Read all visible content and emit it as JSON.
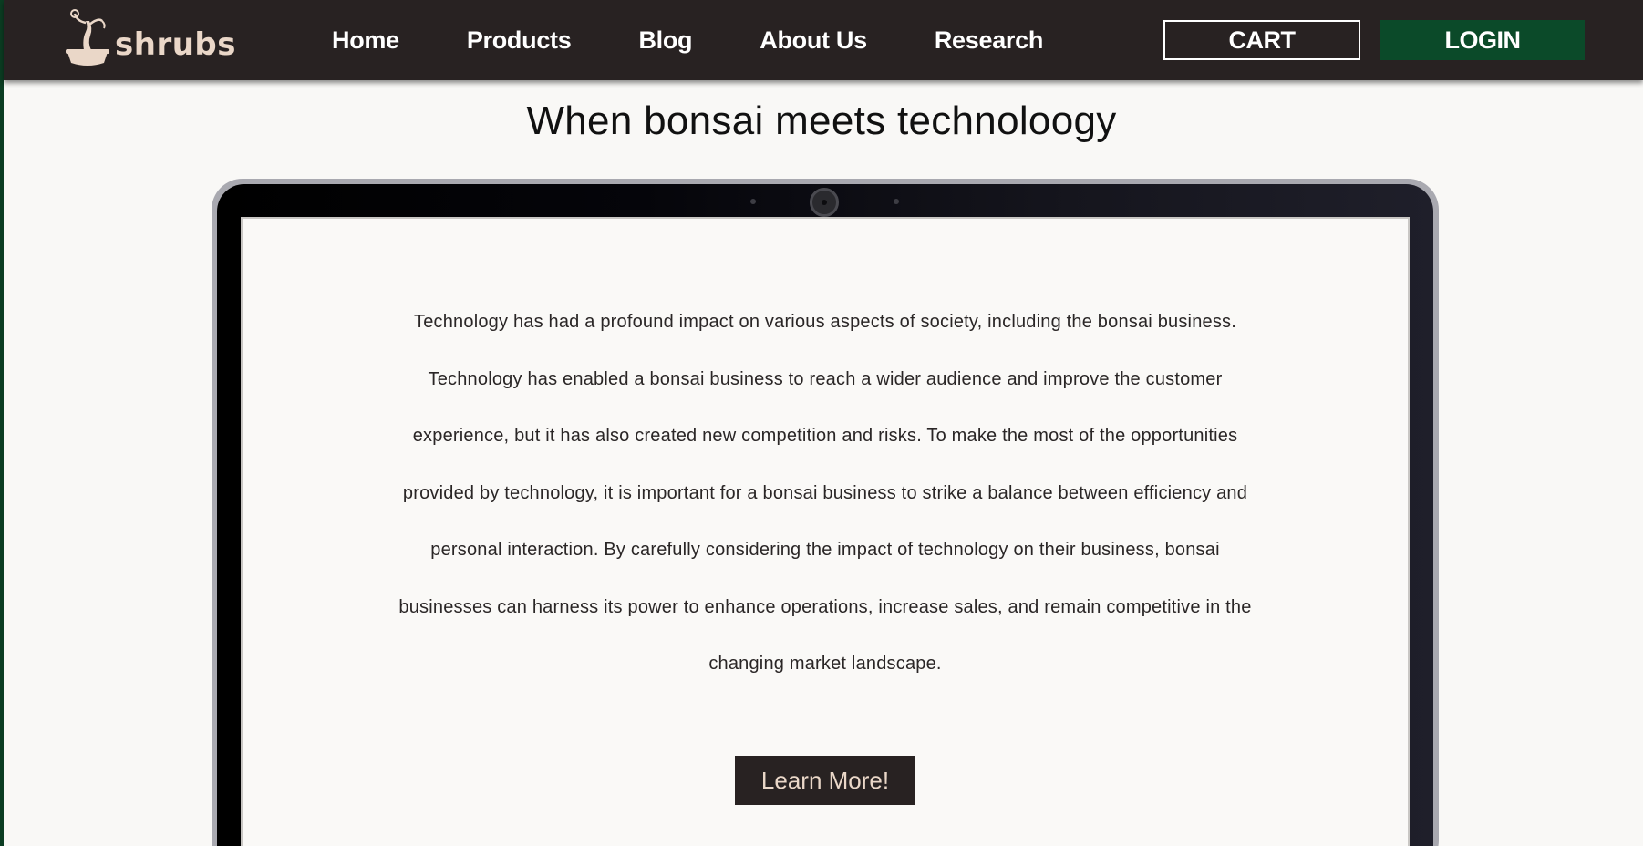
{
  "brand": {
    "name": "shrubs",
    "logo_icon": "bonsai-tree-icon",
    "color": "#ead7c8"
  },
  "nav": {
    "links": [
      "Home",
      "Products",
      "Blog",
      "About Us",
      "Research"
    ],
    "cart_label": "CART",
    "login_label": "LOGIN"
  },
  "section": {
    "title": "When bonsai meets technoloogy",
    "body": "Technology has had a profound impact on various aspects of society, including the bonsai business. Technology has enabled a bonsai business to reach a wider audience and improve the customer experience, but it has also created new competition and risks. To make the most of the opportunities provided by technology, it is important for a bonsai business to strike a balance between efficiency and personal interaction. By carefully considering the impact of technology on their business, bonsai businesses can harness its power to enhance operations, increase sales, and remain competitive in the changing market landscape.",
    "cta_label": "Learn More!"
  },
  "colors": {
    "navbar_bg": "#282222",
    "accent_green": "#0b4a29",
    "page_bg": "#f9f8f6",
    "cta_text": "#ead7c8"
  }
}
